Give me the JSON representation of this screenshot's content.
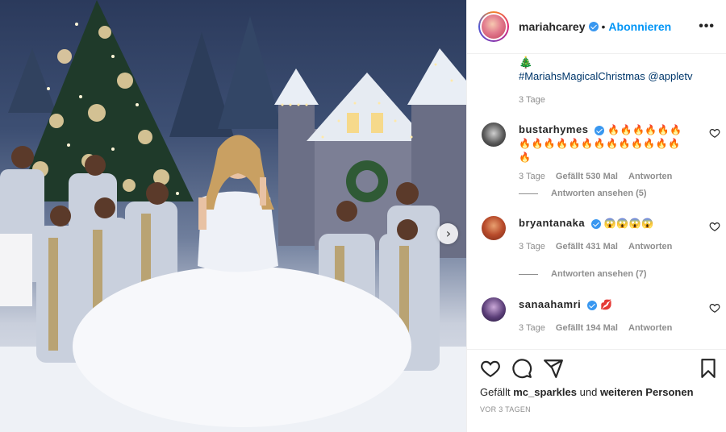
{
  "post": {
    "username": "mariahcarey",
    "separator": "•",
    "follow_label": "Abonnieren",
    "more_label": "•••",
    "image_alt": "Performer in white ball gown with choir in front of snowy Christmas village",
    "next_label": "›"
  },
  "caption": {
    "emoji": "🎄",
    "text": "#MariahsMagicalChristmas @appletv",
    "time": "3 Tage"
  },
  "comments": [
    {
      "user": "bustarhymes",
      "text": "🔥🔥🔥🔥🔥🔥🔥🔥🔥🔥🔥🔥🔥🔥🔥🔥🔥🔥🔥🔥",
      "time": "3 Tage",
      "likes": "Gefällt 530 Mal",
      "reply": "Antworten",
      "view_replies": "Antworten ansehen (5)"
    },
    {
      "user": "bryantanaka",
      "text": "😱😱😱😱",
      "time": "3 Tage",
      "likes": "Gefällt 431 Mal",
      "reply": "Antworten",
      "view_replies": "Antworten ansehen (7)"
    },
    {
      "user": "sanaahamri",
      "text": "💋",
      "time": "3 Tage",
      "likes": "Gefällt 194 Mal",
      "reply": "Antworten"
    }
  ],
  "actions": {
    "liked_prefix": "Gefällt",
    "liked_user": "mc_sparkles",
    "liked_middle": "und",
    "liked_suffix": "weiteren Personen",
    "posted": "VOR 3 TAGEN"
  },
  "colors": {
    "link": "#0095f6",
    "hashtag": "#00376b",
    "muted": "#8e8e8e",
    "verified": "#3897f0"
  },
  "icons": [
    "verified-icon",
    "more-icon",
    "heart-icon",
    "comment-icon",
    "share-icon",
    "bookmark-icon",
    "next-arrow-icon"
  ]
}
